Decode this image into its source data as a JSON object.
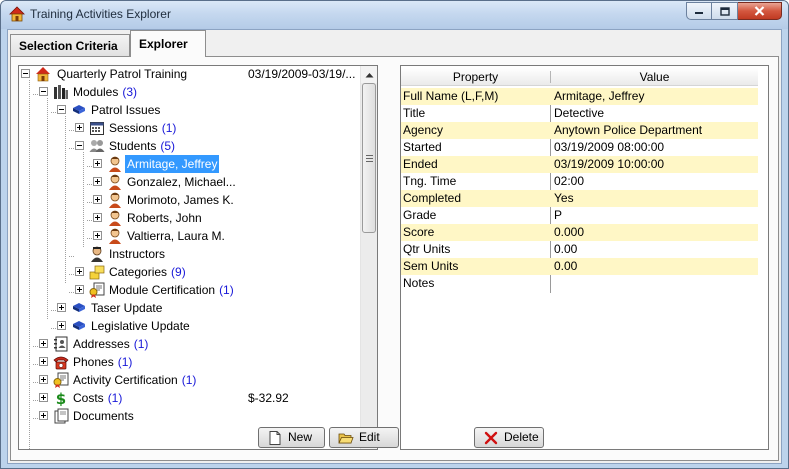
{
  "window": {
    "title": "Training Activities Explorer",
    "icon": "app-house-icon"
  },
  "tabs": [
    {
      "label": "Selection Criteria",
      "active": false
    },
    {
      "label": "Explorer",
      "active": true
    }
  ],
  "tree": {
    "root": {
      "label": "Quarterly Patrol Training",
      "extra": "03/19/2009-03/19/..."
    },
    "modules": {
      "label": "Modules",
      "count": "(3)"
    },
    "patrol_issues": {
      "label": "Patrol Issues"
    },
    "sessions": {
      "label": "Sessions",
      "count": "(1)"
    },
    "students": {
      "label": "Students",
      "count": "(5)"
    },
    "student_list": [
      "Armitage, Jeffrey",
      "Gonzalez, Michael...",
      "Morimoto, James K.",
      "Roberts, John",
      "Valtierra, Laura M."
    ],
    "instructors": {
      "label": "Instructors"
    },
    "categories": {
      "label": "Categories",
      "count": "(9)"
    },
    "module_certification": {
      "label": "Module Certification",
      "count": "(1)"
    },
    "taser_update": {
      "label": "Taser Update"
    },
    "legislative_update": {
      "label": "Legislative Update"
    },
    "addresses": {
      "label": "Addresses",
      "count": "(1)"
    },
    "phones": {
      "label": "Phones",
      "count": "(1)"
    },
    "activity_certification": {
      "label": "Activity Certification",
      "count": "(1)"
    },
    "costs": {
      "label": "Costs",
      "count": "(1)",
      "extra": "$-32.92"
    },
    "documents": {
      "label": "Documents"
    }
  },
  "grid": {
    "headers": {
      "property": "Property",
      "value": "Value"
    },
    "rows": [
      {
        "property": "Full Name (L,F,M)",
        "value": "Armitage, Jeffrey"
      },
      {
        "property": "Title",
        "value": "Detective"
      },
      {
        "property": "Agency",
        "value": "Anytown Police Department"
      },
      {
        "property": "Started",
        "value": "03/19/2009 08:00:00"
      },
      {
        "property": "Ended",
        "value": "03/19/2009 10:00:00"
      },
      {
        "property": "Tng. Time",
        "value": "02:00"
      },
      {
        "property": "Completed",
        "value": "Yes"
      },
      {
        "property": "Grade",
        "value": "P"
      },
      {
        "property": "Score",
        "value": "0.000"
      },
      {
        "property": "Qtr Units",
        "value": "0.00"
      },
      {
        "property": "Sem Units",
        "value": "0.00"
      },
      {
        "property": "Notes",
        "value": ""
      }
    ]
  },
  "buttons": {
    "new": "New",
    "edit": "Edit",
    "delete": "Delete"
  },
  "colors": {
    "selection": "#3399ff",
    "count_text": "#1818d8",
    "grid_alt_row": "#fff7c6",
    "delete_icon": "#d01010"
  }
}
